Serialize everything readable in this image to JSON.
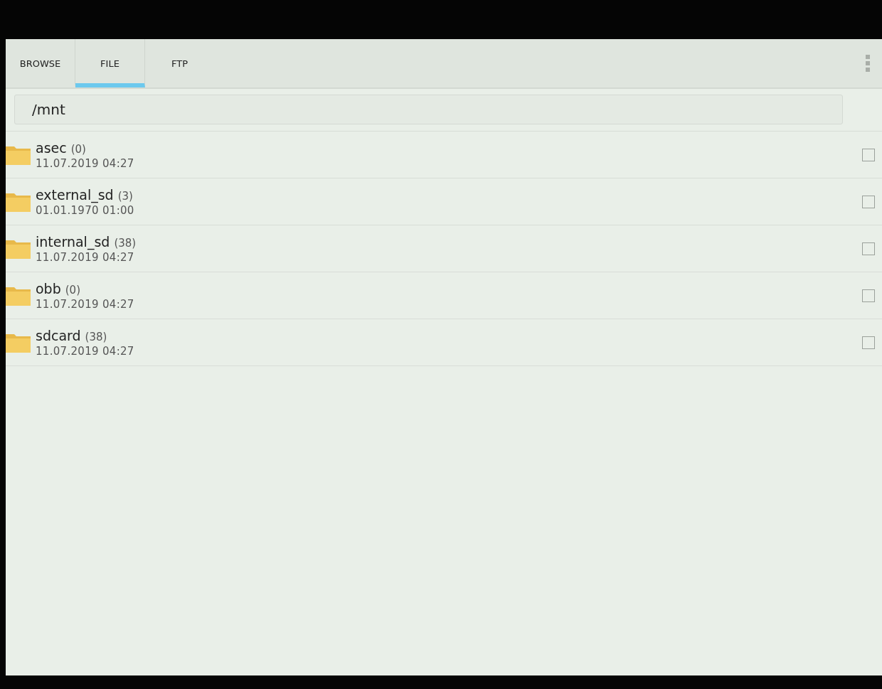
{
  "tabs": [
    {
      "label": "BROWSE",
      "selected": false
    },
    {
      "label": "FILE",
      "selected": true
    },
    {
      "label": "FTP",
      "selected": false
    }
  ],
  "path_field": {
    "value": "/mnt"
  },
  "files": [
    {
      "name": "asec",
      "count": "(0)",
      "date": "11.07.2019 04:27",
      "checked": false
    },
    {
      "name": "external_sd",
      "count": "(3)",
      "date": "01.01.1970 01:00",
      "checked": false
    },
    {
      "name": "internal_sd",
      "count": "(38)",
      "date": "11.07.2019 04:27",
      "checked": false
    },
    {
      "name": "obb",
      "count": "(0)",
      "date": "11.07.2019 04:27",
      "checked": false
    },
    {
      "name": "sdcard",
      "count": "(38)",
      "date": "11.07.2019 04:27",
      "checked": false
    }
  ]
}
